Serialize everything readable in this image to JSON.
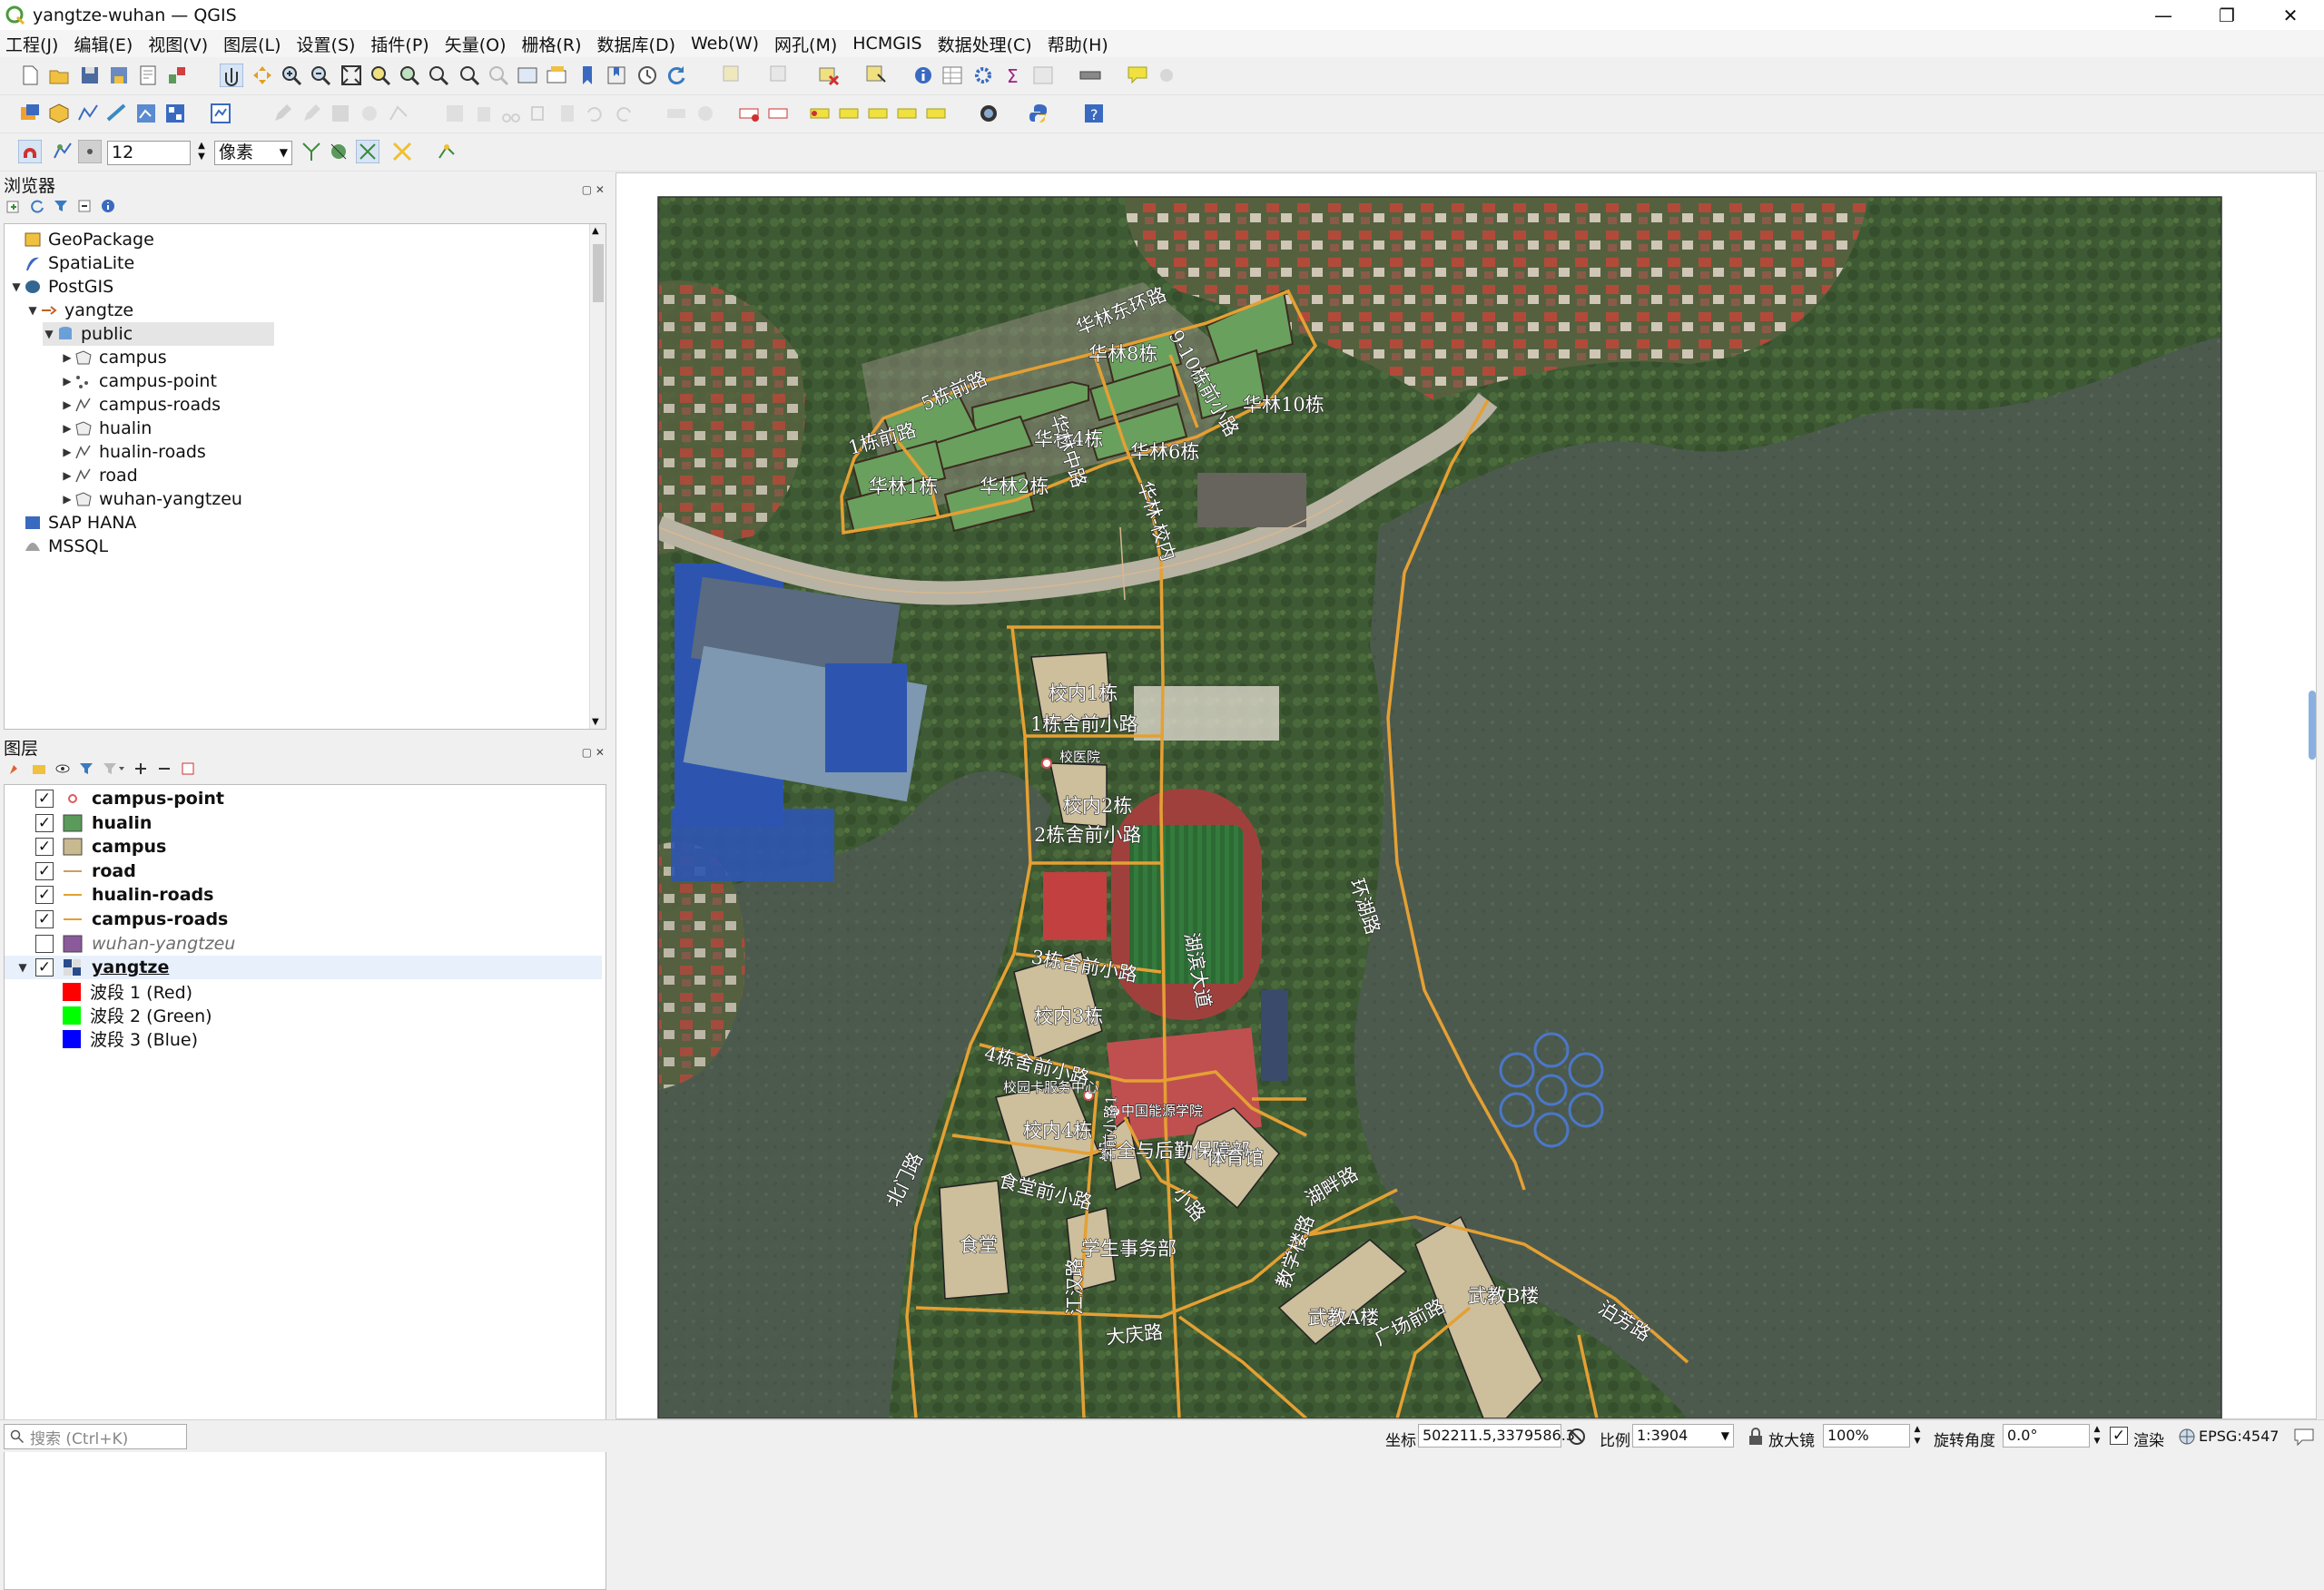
{
  "window": {
    "title": "yangtze-wuhan — QGIS",
    "controls": [
      "—",
      "❐",
      "✕"
    ]
  },
  "menu": [
    "工程(J)",
    "编辑(E)",
    "视图(V)",
    "图层(L)",
    "设置(S)",
    "插件(P)",
    "矢量(O)",
    "栅格(R)",
    "数据库(D)",
    "Web(W)",
    "网孔(M)",
    "HCMGIS",
    "数据处理(C)",
    "帮助(H)"
  ],
  "snapping": {
    "tolerance": "12",
    "unit": "像素"
  },
  "browser": {
    "title": "浏览器",
    "items": [
      {
        "label": "GeoPackage",
        "icon": "geopackage-icon",
        "level": 0,
        "expand": ""
      },
      {
        "label": "SpatiaLite",
        "icon": "spatialite-icon",
        "level": 0,
        "expand": ""
      },
      {
        "label": "PostGIS",
        "icon": "postgis-icon",
        "level": 0,
        "expand": "▼"
      },
      {
        "label": "yangtze",
        "icon": "connection-icon",
        "level": 1,
        "expand": "▼"
      },
      {
        "label": "public",
        "icon": "schema-icon",
        "level": 2,
        "expand": "▼"
      },
      {
        "label": "campus",
        "icon": "polygon-layer-icon",
        "level": 3,
        "expand": "▶"
      },
      {
        "label": "campus-point",
        "icon": "point-layer-icon",
        "level": 3,
        "expand": "▶"
      },
      {
        "label": "campus-roads",
        "icon": "line-layer-icon",
        "level": 3,
        "expand": "▶"
      },
      {
        "label": "hualin",
        "icon": "polygon-layer-icon",
        "level": 3,
        "expand": "▶"
      },
      {
        "label": "hualin-roads",
        "icon": "line-layer-icon",
        "level": 3,
        "expand": "▶"
      },
      {
        "label": "road",
        "icon": "line-layer-icon",
        "level": 3,
        "expand": "▶"
      },
      {
        "label": "wuhan-yangtzeu",
        "icon": "polygon-layer-icon",
        "level": 3,
        "expand": "▶"
      },
      {
        "label": "SAP HANA",
        "icon": "saphana-icon",
        "level": 0,
        "expand": ""
      },
      {
        "label": "MSSQL",
        "icon": "mssql-icon",
        "level": 0,
        "expand": ""
      }
    ]
  },
  "layers": {
    "title": "图层",
    "items": [
      {
        "label": "campus-point",
        "checked": true,
        "symbol": "point",
        "color": "#e05a5a",
        "style": "bold"
      },
      {
        "label": "hualin",
        "checked": true,
        "symbol": "fill",
        "color": "#5a9a5a",
        "style": "bold"
      },
      {
        "label": "campus",
        "checked": true,
        "symbol": "fill",
        "color": "#c9b991",
        "style": "bold"
      },
      {
        "label": "road",
        "checked": true,
        "symbol": "line",
        "color": "#c8a060",
        "style": "bold"
      },
      {
        "label": "hualin-roads",
        "checked": true,
        "symbol": "line",
        "color": "#e0a030",
        "style": "bold"
      },
      {
        "label": "campus-roads",
        "checked": true,
        "symbol": "line",
        "color": "#e0a030",
        "style": "bold"
      },
      {
        "label": "wuhan-yangtzeu",
        "checked": false,
        "symbol": "fill",
        "color": "#8a5a9a",
        "style": "italic"
      },
      {
        "label": "yangtze",
        "checked": true,
        "symbol": "raster",
        "color": "#2a4a8a",
        "style": "bold-underline"
      }
    ],
    "bands": [
      {
        "label": "波段 1 (Red)",
        "color": "#ff0000"
      },
      {
        "label": "波段 2 (Green)",
        "color": "#00ff00"
      },
      {
        "label": "波段 3 (Blue)",
        "color": "#0000ff"
      }
    ]
  },
  "map_labels": {
    "hualin8": "华林8栋",
    "hualin10": "华林10栋",
    "hualin4": "华林4栋",
    "hualin6": "华林6栋",
    "hualin1": "华林1栋",
    "hualin2": "华林2栋",
    "road5": "5栋前路",
    "road1": "1栋前路",
    "ring_road": "华林东环路",
    "road910": "9-10栋前小路",
    "hualin_campus_road": "华林-校内",
    "huazhong": "华林中路",
    "bld1": "校内1栋",
    "dorm1": "1栋舍前小路",
    "bld2": "校内2栋",
    "dorm2": "2栋舍前小路",
    "dorm3": "3栋舍前小路",
    "bld3": "校内3栋",
    "dorm4": "4栋舍前小路",
    "bld4": "校内4栋",
    "card_center": "校园卡服务中心",
    "security": "安全与后勤保障部",
    "gym": "体育馆",
    "canteen_road": "食堂前小路",
    "canteen": "食堂",
    "student_affairs": "学生事务部",
    "daqing": "大庆路",
    "wujiao_a": "武教A楼",
    "wujiao_b": "武教B楼",
    "hubin": "环湖路",
    "lakeshore_road": "湖滨大道",
    "north_road": "北门路",
    "small_road": "小路",
    "east_lake_road": "湖畔路",
    "plaza": "广场前路",
    "bofang": "泊芳路",
    "jiangyuan": "江汉路",
    "jiaowu": "学前小路1",
    "card_dept": "中国能源学院",
    "canteen_lbl": "教学楼路",
    "pt_label": "校医院"
  },
  "status": {
    "search_placeholder": "搜索 (Ctrl+K)",
    "coord_label": "坐标",
    "coord_value": "502211.5,3379586.3",
    "scale_label": "比例",
    "scale_value": "1:3904",
    "magnifier_label": "放大镜",
    "magnifier_value": "100%",
    "rotation_label": "旋转角度",
    "rotation_value": "0.0°",
    "render_label": "渲染",
    "crs": "EPSG:4547"
  }
}
